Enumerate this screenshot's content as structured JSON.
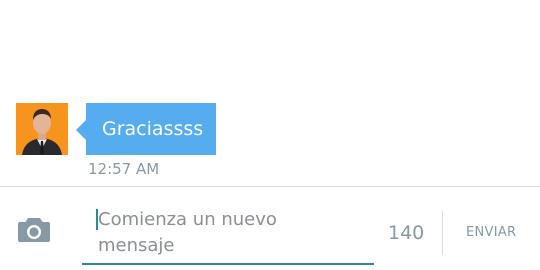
{
  "conversation": {
    "messages": [
      {
        "text": "Graciassss",
        "time": "12:57 AM",
        "avatar_bg": "#f7941d"
      }
    ],
    "bubble_color": "#55acee"
  },
  "composer": {
    "placeholder": "Comienza un nuevo mensaje",
    "char_count": "140",
    "send_label": "ENVIAR",
    "camera_icon": "camera-icon",
    "accent_color": "#2b8a9a"
  }
}
